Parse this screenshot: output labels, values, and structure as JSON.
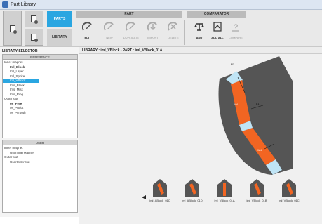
{
  "window": {
    "title": "Part Library"
  },
  "modes": {
    "parts": "PARTS",
    "library": "LIBRARY"
  },
  "part_section": {
    "title": "PART",
    "tools": [
      {
        "label": "EDIT",
        "enabled": true
      },
      {
        "label": "NEW",
        "enabled": false
      },
      {
        "label": "DUPLICATE",
        "enabled": false
      },
      {
        "label": "IMPORT",
        "enabled": false
      },
      {
        "label": "DELETE",
        "enabled": false
      }
    ]
  },
  "comparator_section": {
    "title": "COMPARATOR",
    "tools": [
      {
        "label": "ADD",
        "enabled": true
      },
      {
        "label": "ADD ALL",
        "enabled": true
      },
      {
        "label": "COMPARE",
        "enabled": false
      }
    ]
  },
  "library_selector": {
    "title": "LIBRARY SELECTOR",
    "reference": {
      "title": "REFERENCE",
      "items": [
        {
          "label": "Inner magnet",
          "indent": 0,
          "bold": false,
          "selected": false
        },
        {
          "label": "Iml_Block",
          "indent": 1,
          "bold": true,
          "selected": false
        },
        {
          "label": "Iml_Layer",
          "indent": 1,
          "bold": false,
          "selected": false
        },
        {
          "label": "Iml_Spoke",
          "indent": 1,
          "bold": false,
          "selected": false
        },
        {
          "label": "Iml_VBlock",
          "indent": 1,
          "bold": false,
          "selected": true
        },
        {
          "label": "Ims_Block",
          "indent": 1,
          "bold": false,
          "selected": false
        },
        {
          "label": "Ims_Misc",
          "indent": 1,
          "bold": false,
          "selected": false
        },
        {
          "label": "Ims_Ring",
          "indent": 1,
          "bold": false,
          "selected": false
        },
        {
          "label": "Outer slot",
          "indent": 0,
          "bold": false,
          "selected": false
        },
        {
          "label": "os_Free",
          "indent": 1,
          "bold": true,
          "selected": false
        },
        {
          "label": "os_PtSlot",
          "indent": 1,
          "bold": false,
          "selected": false
        },
        {
          "label": "os_PtTooth",
          "indent": 1,
          "bold": false,
          "selected": false
        }
      ]
    },
    "user": {
      "title": "USER",
      "items": [
        {
          "label": "Inner magnet",
          "indent": 0
        },
        {
          "label": "UserInnerMagnet",
          "indent": 1
        },
        {
          "label": "Outer slot",
          "indent": 0
        },
        {
          "label": "UserOuterSlot",
          "indent": 1
        }
      ]
    }
  },
  "breadcrumb": "LIBRARY : iml_VBlock  -  PART : iml_VBlock_01A",
  "drawing": {
    "dimension_labels": [
      "W4",
      "L1",
      "R1",
      "W4"
    ],
    "colors": {
      "lamination": "#555555",
      "magnet": "#f26522",
      "pocket": "#bfe4f5",
      "background": "#f0f0f0"
    }
  },
  "thumbnails": [
    {
      "label": "iml_ABlock_01C"
    },
    {
      "label": "iml_ABlock_01D"
    },
    {
      "label": "iml_VBlock_01A"
    },
    {
      "label": "iml_VBlock_01B"
    },
    {
      "label": "iml_VBlock_01C"
    }
  ]
}
